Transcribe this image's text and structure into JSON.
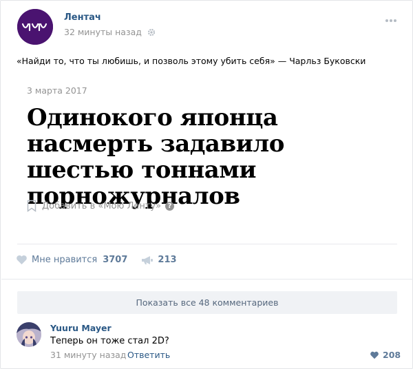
{
  "post": {
    "author": "Лентач",
    "time": "32 минуты назад",
    "quote": "«Найди то, что ты любишь, и позволь этому убить себя» — Чарльз Буковски",
    "card": {
      "date": "3 марта 2017",
      "title": "Одинокого японца насмерть задавило шестью тоннами порножурналов",
      "add_label": "Добавить в «Мою Ленту»"
    },
    "likes": {
      "label": "Мне нравится",
      "count": "3707"
    },
    "shares": {
      "count": "213"
    }
  },
  "comments": {
    "show_all": "Показать все 48 комментариев",
    "items": [
      {
        "author": "Yuuru Mayer",
        "text": "Теперь он тоже стал 2D?",
        "time": "31 минуту назад",
        "reply": "Ответить",
        "likes": "208"
      }
    ]
  },
  "colors": {
    "link": "#2a5885",
    "muted": "#939393",
    "action": "#5e7a99",
    "brand": "#4a1370"
  },
  "icons": [
    "brand-logo-icon",
    "gear-icon",
    "more-dots-icon",
    "bookmark-icon",
    "help-icon",
    "heart-icon",
    "megaphone-icon"
  ]
}
